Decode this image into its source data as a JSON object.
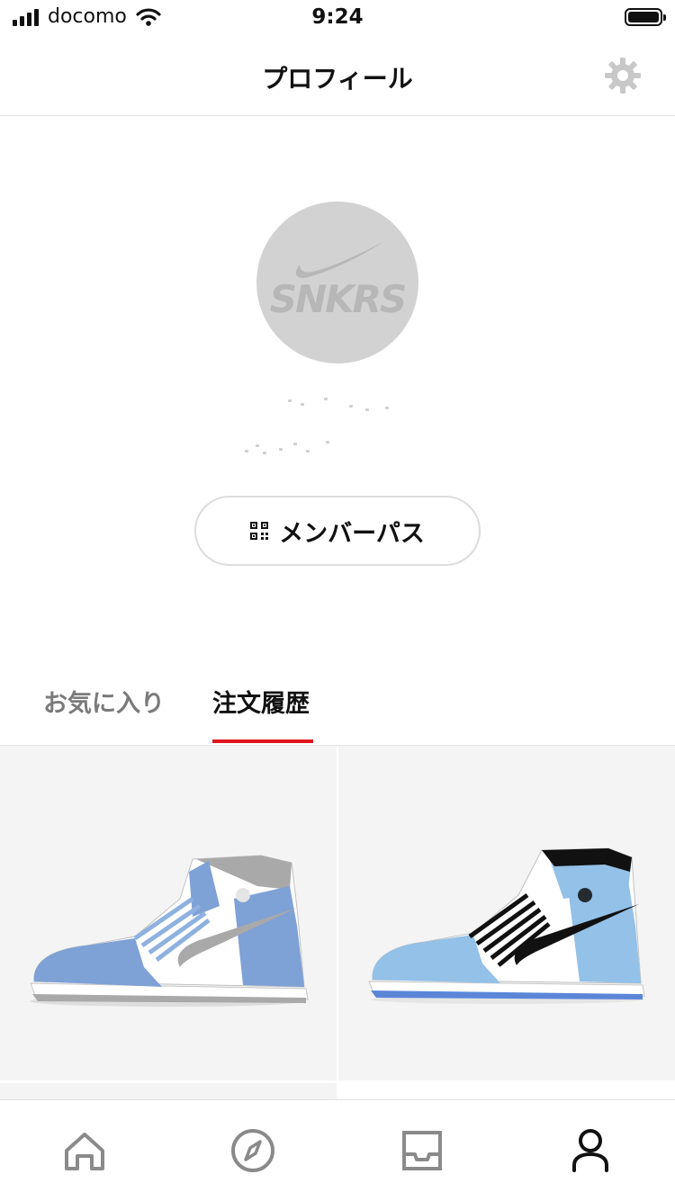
{
  "status_bar": {
    "carrier": "docomo",
    "time": "9:24"
  },
  "header": {
    "title": "プロフィール",
    "settings_icon": "gear-icon"
  },
  "profile": {
    "avatar_text": "SNKRS",
    "member_pass_label": "メンバーパス",
    "member_pass_icon": "qr-code-icon"
  },
  "tabs": [
    {
      "label": "お気に入り",
      "active": false
    },
    {
      "label": "注文履歴",
      "active": true
    }
  ],
  "products": [
    {
      "name": "sneaker-hyper-royal",
      "colors": [
        "#7ea1d6",
        "#a9a9a9",
        "#ffffff"
      ]
    },
    {
      "name": "sneaker-university-blue",
      "colors": [
        "#93c1e8",
        "#111111",
        "#ffffff"
      ]
    }
  ],
  "bottom_nav": [
    {
      "icon": "home-icon",
      "active": false
    },
    {
      "icon": "compass-icon",
      "active": false
    },
    {
      "icon": "inbox-icon",
      "active": false
    },
    {
      "icon": "profile-icon",
      "active": true
    }
  ],
  "colors": {
    "accent": "#e0161f",
    "inactive": "#8a8a8a",
    "active": "#111111"
  }
}
